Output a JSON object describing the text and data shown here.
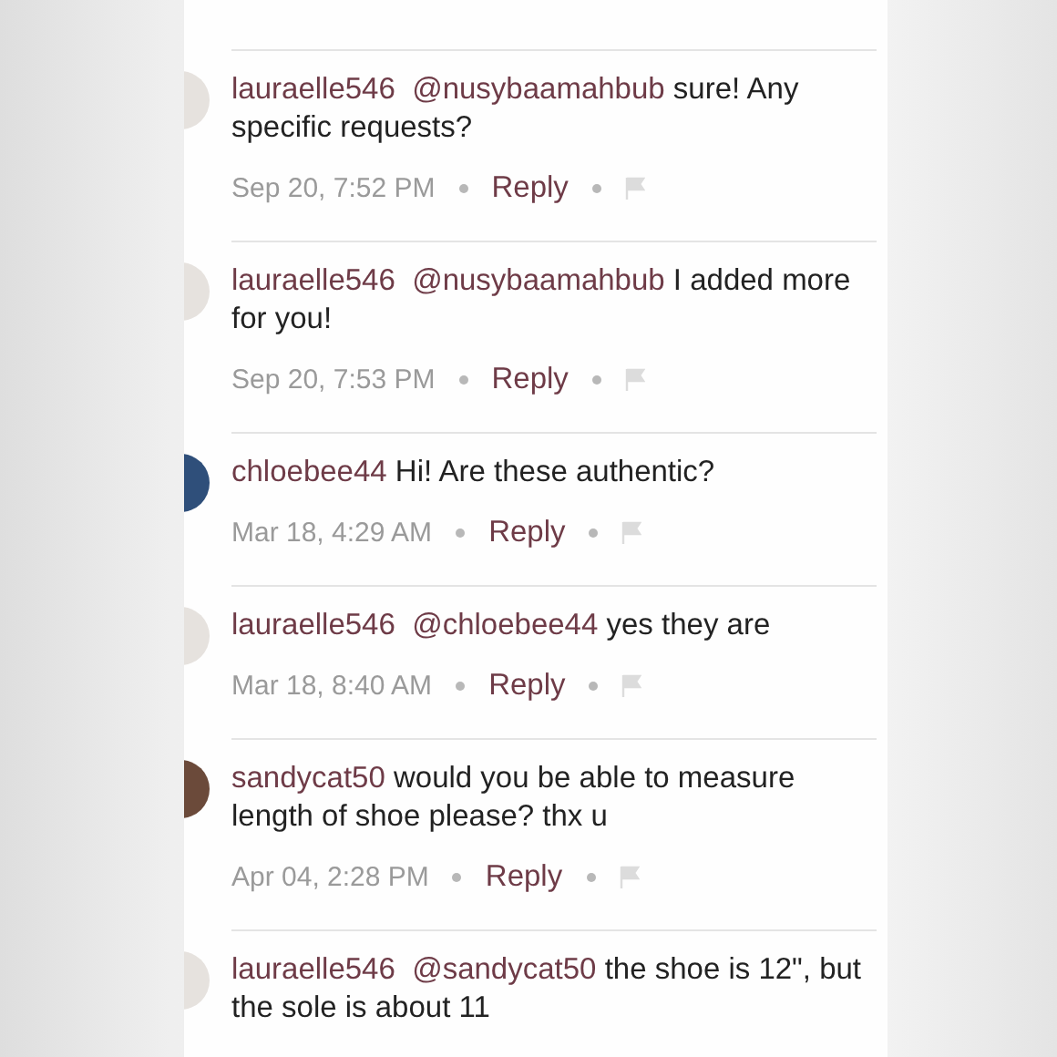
{
  "comments": [
    {
      "user": "lauraelle546",
      "mention": "@nusybaamahbub",
      "text": "sure! Any specific requests?",
      "time": "Sep 20, 7:52 PM",
      "reply": "Reply",
      "color": "#e6e2de"
    },
    {
      "user": "lauraelle546",
      "mention": "@nusybaamahbub",
      "text": "I added more for you!",
      "time": "Sep 20, 7:53 PM",
      "reply": "Reply",
      "color": "#e6e2de"
    },
    {
      "user": "chloebee44",
      "text": "Hi! Are these authentic?",
      "time": "Mar 18, 4:29 AM",
      "reply": "Reply",
      "color": "#2f4f7a"
    },
    {
      "user": "lauraelle546",
      "mention": "@chloebee44",
      "text": "yes they are",
      "time": "Mar 18, 8:40 AM",
      "reply": "Reply",
      "color": "#e6e2de"
    },
    {
      "user": "sandycat50",
      "text": "would you be able to measure length of shoe please? thx u",
      "time": "Apr 04, 2:28 PM",
      "reply": "Reply",
      "color": "#6b4a3a"
    },
    {
      "user": "lauraelle546",
      "mention": "@sandycat50",
      "text": "the shoe is 12\", but the sole is about 11",
      "color": "#e6e2de"
    }
  ]
}
